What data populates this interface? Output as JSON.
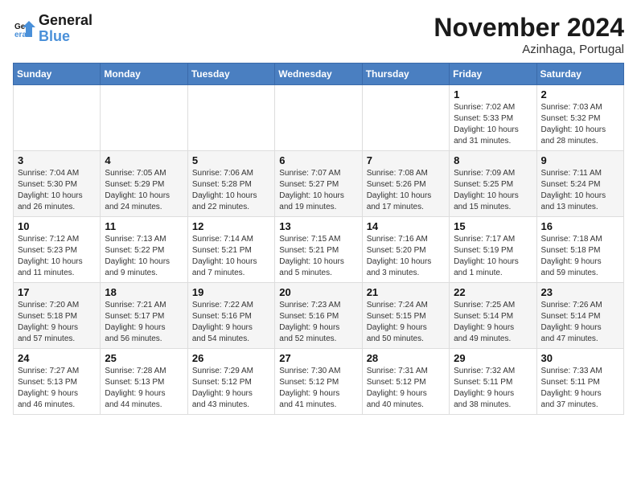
{
  "header": {
    "logo_general": "General",
    "logo_blue": "Blue",
    "month_title": "November 2024",
    "subtitle": "Azinhaga, Portugal"
  },
  "days_of_week": [
    "Sunday",
    "Monday",
    "Tuesday",
    "Wednesday",
    "Thursday",
    "Friday",
    "Saturday"
  ],
  "weeks": [
    [
      {
        "day": "",
        "info": ""
      },
      {
        "day": "",
        "info": ""
      },
      {
        "day": "",
        "info": ""
      },
      {
        "day": "",
        "info": ""
      },
      {
        "day": "",
        "info": ""
      },
      {
        "day": "1",
        "info": "Sunrise: 7:02 AM\nSunset: 5:33 PM\nDaylight: 10 hours\nand 31 minutes."
      },
      {
        "day": "2",
        "info": "Sunrise: 7:03 AM\nSunset: 5:32 PM\nDaylight: 10 hours\nand 28 minutes."
      }
    ],
    [
      {
        "day": "3",
        "info": "Sunrise: 7:04 AM\nSunset: 5:30 PM\nDaylight: 10 hours\nand 26 minutes."
      },
      {
        "day": "4",
        "info": "Sunrise: 7:05 AM\nSunset: 5:29 PM\nDaylight: 10 hours\nand 24 minutes."
      },
      {
        "day": "5",
        "info": "Sunrise: 7:06 AM\nSunset: 5:28 PM\nDaylight: 10 hours\nand 22 minutes."
      },
      {
        "day": "6",
        "info": "Sunrise: 7:07 AM\nSunset: 5:27 PM\nDaylight: 10 hours\nand 19 minutes."
      },
      {
        "day": "7",
        "info": "Sunrise: 7:08 AM\nSunset: 5:26 PM\nDaylight: 10 hours\nand 17 minutes."
      },
      {
        "day": "8",
        "info": "Sunrise: 7:09 AM\nSunset: 5:25 PM\nDaylight: 10 hours\nand 15 minutes."
      },
      {
        "day": "9",
        "info": "Sunrise: 7:11 AM\nSunset: 5:24 PM\nDaylight: 10 hours\nand 13 minutes."
      }
    ],
    [
      {
        "day": "10",
        "info": "Sunrise: 7:12 AM\nSunset: 5:23 PM\nDaylight: 10 hours\nand 11 minutes."
      },
      {
        "day": "11",
        "info": "Sunrise: 7:13 AM\nSunset: 5:22 PM\nDaylight: 10 hours\nand 9 minutes."
      },
      {
        "day": "12",
        "info": "Sunrise: 7:14 AM\nSunset: 5:21 PM\nDaylight: 10 hours\nand 7 minutes."
      },
      {
        "day": "13",
        "info": "Sunrise: 7:15 AM\nSunset: 5:21 PM\nDaylight: 10 hours\nand 5 minutes."
      },
      {
        "day": "14",
        "info": "Sunrise: 7:16 AM\nSunset: 5:20 PM\nDaylight: 10 hours\nand 3 minutes."
      },
      {
        "day": "15",
        "info": "Sunrise: 7:17 AM\nSunset: 5:19 PM\nDaylight: 10 hours\nand 1 minute."
      },
      {
        "day": "16",
        "info": "Sunrise: 7:18 AM\nSunset: 5:18 PM\nDaylight: 9 hours\nand 59 minutes."
      }
    ],
    [
      {
        "day": "17",
        "info": "Sunrise: 7:20 AM\nSunset: 5:18 PM\nDaylight: 9 hours\nand 57 minutes."
      },
      {
        "day": "18",
        "info": "Sunrise: 7:21 AM\nSunset: 5:17 PM\nDaylight: 9 hours\nand 56 minutes."
      },
      {
        "day": "19",
        "info": "Sunrise: 7:22 AM\nSunset: 5:16 PM\nDaylight: 9 hours\nand 54 minutes."
      },
      {
        "day": "20",
        "info": "Sunrise: 7:23 AM\nSunset: 5:16 PM\nDaylight: 9 hours\nand 52 minutes."
      },
      {
        "day": "21",
        "info": "Sunrise: 7:24 AM\nSunset: 5:15 PM\nDaylight: 9 hours\nand 50 minutes."
      },
      {
        "day": "22",
        "info": "Sunrise: 7:25 AM\nSunset: 5:14 PM\nDaylight: 9 hours\nand 49 minutes."
      },
      {
        "day": "23",
        "info": "Sunrise: 7:26 AM\nSunset: 5:14 PM\nDaylight: 9 hours\nand 47 minutes."
      }
    ],
    [
      {
        "day": "24",
        "info": "Sunrise: 7:27 AM\nSunset: 5:13 PM\nDaylight: 9 hours\nand 46 minutes."
      },
      {
        "day": "25",
        "info": "Sunrise: 7:28 AM\nSunset: 5:13 PM\nDaylight: 9 hours\nand 44 minutes."
      },
      {
        "day": "26",
        "info": "Sunrise: 7:29 AM\nSunset: 5:12 PM\nDaylight: 9 hours\nand 43 minutes."
      },
      {
        "day": "27",
        "info": "Sunrise: 7:30 AM\nSunset: 5:12 PM\nDaylight: 9 hours\nand 41 minutes."
      },
      {
        "day": "28",
        "info": "Sunrise: 7:31 AM\nSunset: 5:12 PM\nDaylight: 9 hours\nand 40 minutes."
      },
      {
        "day": "29",
        "info": "Sunrise: 7:32 AM\nSunset: 5:11 PM\nDaylight: 9 hours\nand 38 minutes."
      },
      {
        "day": "30",
        "info": "Sunrise: 7:33 AM\nSunset: 5:11 PM\nDaylight: 9 hours\nand 37 minutes."
      }
    ]
  ]
}
